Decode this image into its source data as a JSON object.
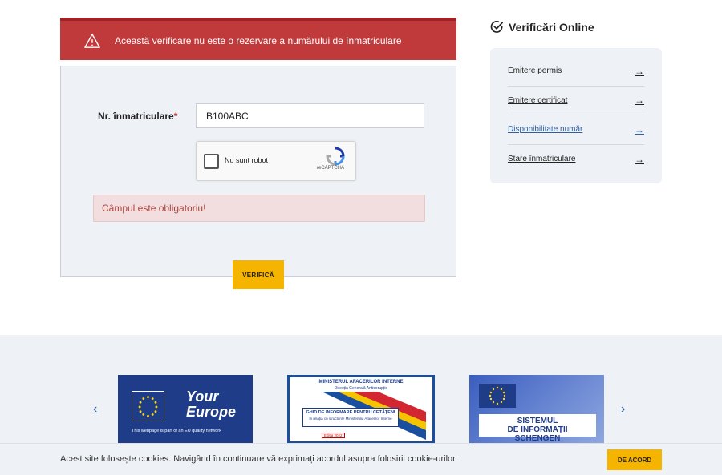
{
  "alert": {
    "text": "Această verificare nu este o rezervare a numărului de înmatriculare"
  },
  "form": {
    "plate_label": "Nr. înmatriculare",
    "required_mark": "*",
    "plate_value": "B100ABC",
    "captcha_label": "Nu sunt robot",
    "captcha_brand": "reCAPTCHA",
    "error_text": "Câmpul este obligatoriu!",
    "submit_label": "VERIFICĂ"
  },
  "sidebar": {
    "title": "Verificări Online",
    "items": [
      {
        "label": "Emitere permis"
      },
      {
        "label": "Emitere certificat"
      },
      {
        "label": "Disponibilitate număr"
      },
      {
        "label": "Stare înmatriculare"
      }
    ]
  },
  "banners": {
    "your_europe": {
      "title_line1": "Your",
      "title_line2": "Europe",
      "caption": "This webpage is part of an EU quality network"
    },
    "mai": {
      "header": "MINISTERUL AFACERILOR INTERNE",
      "subheader": "Direcția Generală Anticorupție",
      "box_title": "GHID DE INFORMARE PENTRU CETĂȚENI",
      "box_sub": "în relația cu structurile Ministerului Afacerilor Interne",
      "edition": "Ediția 2022"
    },
    "schengen": {
      "line1": "SISTEMUL",
      "line2": "DE INFORMAȚII SCHENGEN"
    }
  },
  "cookie": {
    "text": "Acest site folosește cookies. Navigând în continuare vă exprimați acordul asupra folosirii cookie-urilor.",
    "accept_label": "DE ACORD"
  },
  "colors": {
    "alert": "#c0393b",
    "accent": "#f5b400",
    "link_active": "#2d5fa3"
  }
}
